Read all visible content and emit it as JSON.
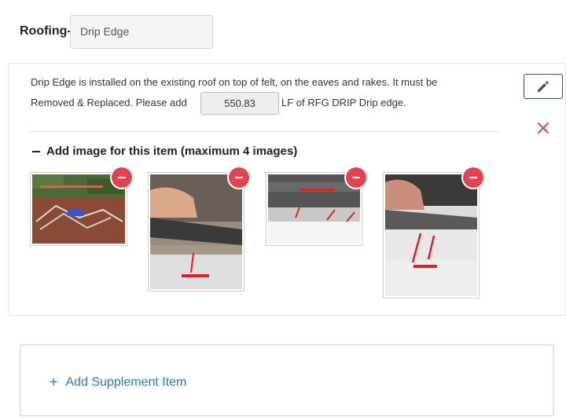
{
  "header": {
    "category_label": "Roofing-",
    "item_name": "Drip Edge"
  },
  "item": {
    "description_line1": "Drip Edge is installed on the existing roof on top of felt, on the eaves and rakes. It must be",
    "description_line2_before": "Removed & Replaced. Please add",
    "quantity": "550.83",
    "description_line2_after": "LF of RFG DRIP Drip edge.",
    "edit_icon": "pencil-icon",
    "delete_icon": "close-icon"
  },
  "images_section": {
    "toggle_symbol": "minus",
    "title": "Add image for this item (maximum 4 images)",
    "images": [
      {
        "name": "photo-1",
        "remove_icon": "minus-circle-icon"
      },
      {
        "name": "photo-2",
        "remove_icon": "minus-circle-icon"
      },
      {
        "name": "photo-3",
        "remove_icon": "minus-circle-icon"
      },
      {
        "name": "photo-4",
        "remove_icon": "minus-circle-icon"
      }
    ]
  },
  "supplement": {
    "add_label": "Add Supplement Item",
    "icon": "plus-icon"
  },
  "colors": {
    "accent_blue": "#2e74b5",
    "danger_red": "#e0454f",
    "edit_border": "#2e4d6b"
  }
}
